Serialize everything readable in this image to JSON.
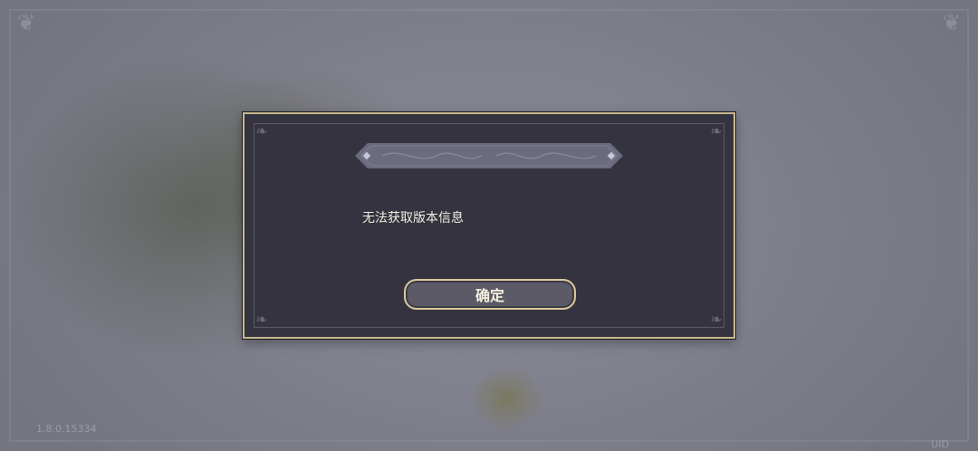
{
  "dialog": {
    "title": "",
    "message": "无法获取版本信息",
    "ok_label": "确定"
  },
  "footer": {
    "version": "1.8.0.15334",
    "uid_label": "UID"
  },
  "colors": {
    "dialog_bg": "#34333f",
    "gold_border": "#c9b98e",
    "button_bg": "#5b5a66",
    "title_bar": "#6b6b7f",
    "text": "#f1ece0"
  }
}
